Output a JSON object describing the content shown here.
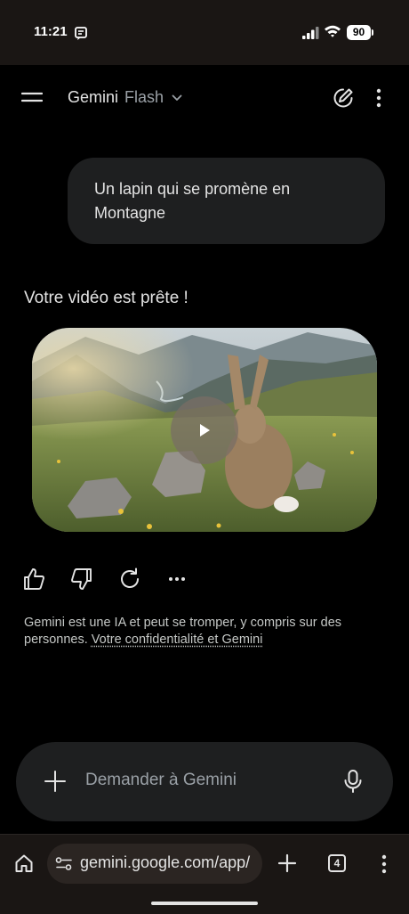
{
  "status_bar": {
    "time": "11:21",
    "battery": "90"
  },
  "header": {
    "app_name": "Gemini",
    "model": "Flash"
  },
  "chat": {
    "user_prompt": "Un lapin qui se promène en Montagne",
    "response": "Votre vidéo est prête !"
  },
  "disclaimer": {
    "text": "Gemini est une IA et peut se tromper, y compris sur des personnes.",
    "link": "Votre confidentialité et Gemini"
  },
  "composer": {
    "placeholder": "Demander à Gemini"
  },
  "browser": {
    "url": "gemini.google.com/app/",
    "tab_count": "4"
  },
  "colors": {
    "background": "#000000",
    "surface": "#1e1f20",
    "browser_bar": "#1a1614"
  },
  "icons": [
    "note-icon",
    "signal-icon",
    "wifi-icon",
    "menu-icon",
    "chevron-down-icon",
    "new-chat-icon",
    "more-vert-icon",
    "play-icon",
    "thumbs-up-icon",
    "thumbs-down-icon",
    "regenerate-icon",
    "more-horiz-icon",
    "add-icon",
    "mic-icon",
    "home-icon",
    "site-settings-icon",
    "new-tab-icon"
  ]
}
